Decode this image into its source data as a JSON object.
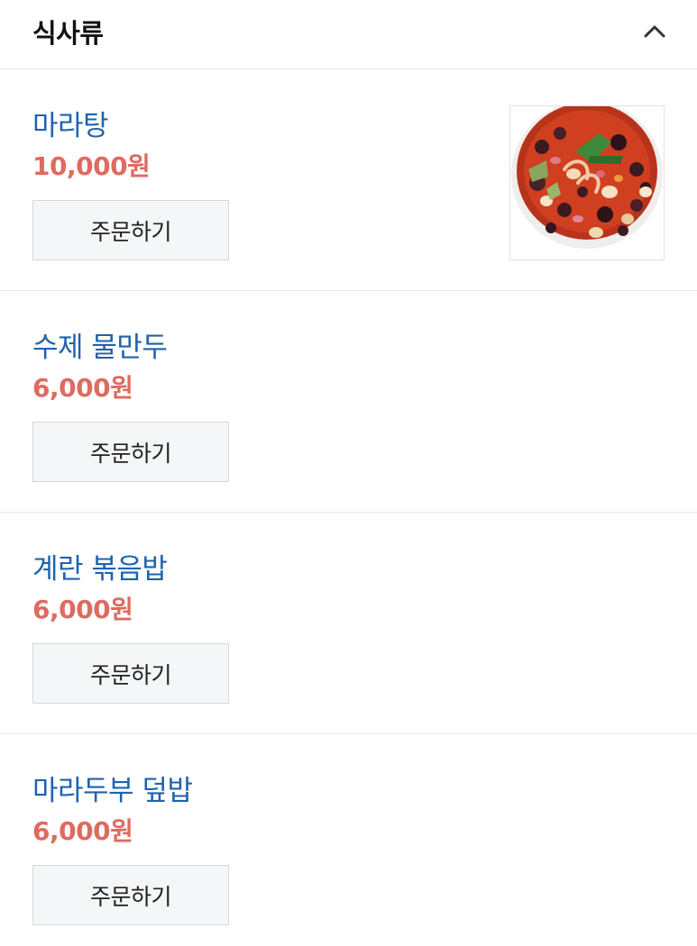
{
  "section": {
    "title": "식사류",
    "collapse_icon": "chevron-up-icon"
  },
  "items": [
    {
      "name": "마라탕",
      "price": "10,000원",
      "order_label": "주문하기",
      "has_image": true,
      "image": "malatang-photo"
    },
    {
      "name": "수제 물만두",
      "price": "6,000원",
      "order_label": "주문하기",
      "has_image": false
    },
    {
      "name": "계란 볶음밥",
      "price": "6,000원",
      "order_label": "주문하기",
      "has_image": false
    },
    {
      "name": "마라두부 덮밥",
      "price": "6,000원",
      "order_label": "주문하기",
      "has_image": false
    }
  ],
  "colors": {
    "item_name": "#1e63ae",
    "price": "#de6a60",
    "button_bg": "#f5f6f8",
    "divider": "#e6e8eb"
  }
}
